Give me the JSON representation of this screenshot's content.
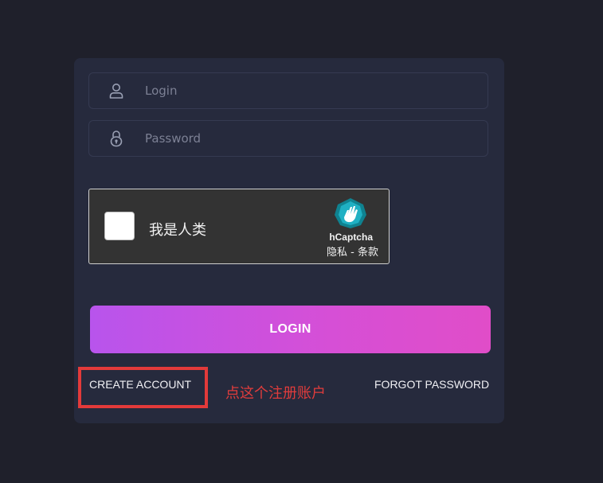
{
  "form": {
    "login_placeholder": "Login",
    "password_placeholder": "Password",
    "login_button": "LOGIN",
    "create_account": "CREATE ACCOUNT",
    "forgot_password": "FORGOT PASSWORD"
  },
  "captcha": {
    "checkbox_label": "我是人类",
    "brand": "hCaptcha",
    "privacy": "隐私",
    "separator": " - ",
    "terms": "条款"
  },
  "annotation": {
    "text": "点这个注册账户",
    "color": "#e33a3a"
  },
  "icons": {
    "login": "user-icon",
    "password": "lock-icon",
    "captcha": "hcaptcha-logo-icon"
  },
  "colors": {
    "background": "#1f202b",
    "card": "#262a3d",
    "button_gradient_start": "#b854ec",
    "button_gradient_end": "#e04dc8"
  }
}
